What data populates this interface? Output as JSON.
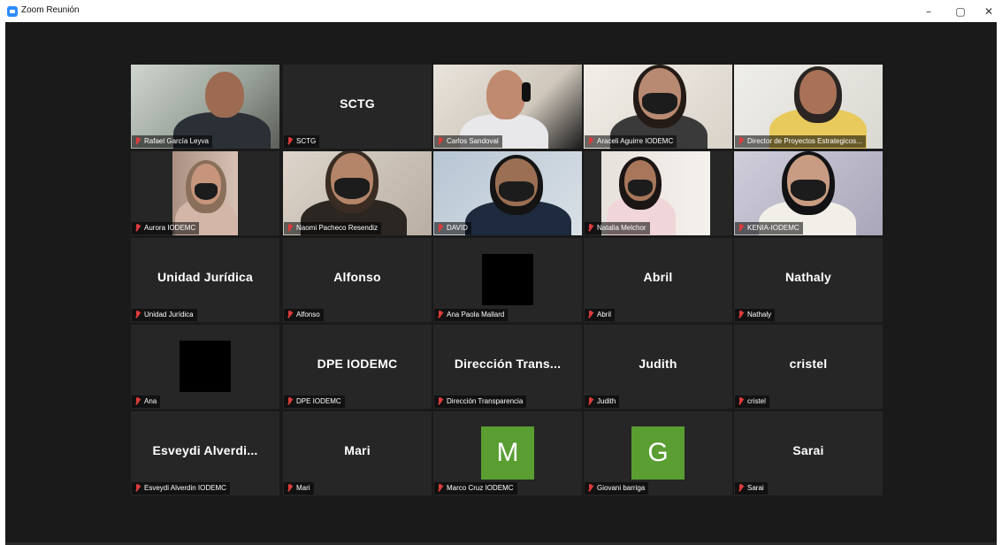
{
  "window": {
    "title": "Zoom Reunión",
    "minimize": "–",
    "restore": "▢",
    "close": "✕"
  },
  "colors": {
    "background": "#1a1a1a",
    "tile": "#262626",
    "active_outline": "#c6e04e",
    "muted_mic": "#e03b3b",
    "avatar_green": "#5a9e32"
  },
  "tiles": [
    {
      "label": "Rafael García Leyva",
      "kind": "video",
      "active": true
    },
    {
      "label": "SCTG",
      "big": "SCTG",
      "kind": "name"
    },
    {
      "label": "Carlos Sandoval",
      "kind": "video"
    },
    {
      "label": "Araceli Aguirre IODEMC",
      "kind": "video"
    },
    {
      "label": "Director de Proyectos Estrategicos...",
      "kind": "video"
    },
    {
      "label": "Aurora IODEMC",
      "kind": "video"
    },
    {
      "label": "Naomi Pacheco Resendiz",
      "kind": "video"
    },
    {
      "label": "DAVID",
      "kind": "video"
    },
    {
      "label": "Natalia Melchor",
      "kind": "video"
    },
    {
      "label": "KENIA-IODEMC",
      "kind": "video"
    },
    {
      "label": "Unidad Jurídica",
      "big": "Unidad Jurídica",
      "kind": "name"
    },
    {
      "label": "Alfonso",
      "big": "Alfonso",
      "kind": "name"
    },
    {
      "label": "Ana Paola Mallard",
      "kind": "black"
    },
    {
      "label": "Abril",
      "big": "Abril",
      "kind": "name"
    },
    {
      "label": "Nathaly",
      "big": "Nathaly",
      "kind": "name"
    },
    {
      "label": "Ana",
      "kind": "black"
    },
    {
      "label": "DPE IODEMC",
      "big": "DPE IODEMC",
      "kind": "name"
    },
    {
      "label": "Dirección Transparencia",
      "big": "Dirección Trans...",
      "kind": "name"
    },
    {
      "label": "Judith",
      "big": "Judith",
      "kind": "name"
    },
    {
      "label": "cristel",
      "big": "cristel",
      "kind": "name"
    },
    {
      "label": "Esveydi Alverdin IODEMC",
      "big": "Esveydi Alverdi...",
      "kind": "name"
    },
    {
      "label": "Mari",
      "big": "Mari",
      "kind": "name"
    },
    {
      "label": "Marco Cruz IODEMC",
      "letter": "M",
      "kind": "letter"
    },
    {
      "label": "Giovani barriga",
      "letter": "G",
      "kind": "letter"
    },
    {
      "label": "Sarai",
      "big": "Sarai",
      "kind": "name"
    }
  ]
}
